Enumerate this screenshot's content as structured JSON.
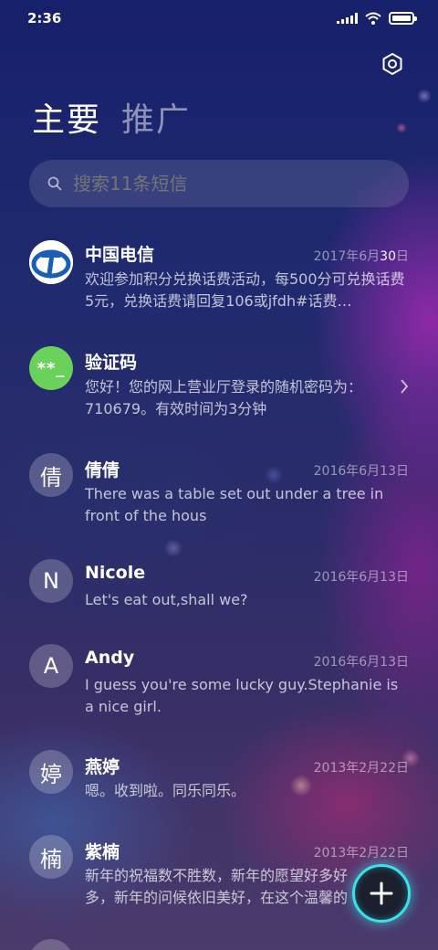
{
  "status_bar": {
    "time": "2:36"
  },
  "tabs": [
    {
      "label": "主要"
    },
    {
      "label": "推广"
    }
  ],
  "search": {
    "placeholder": "搜索11条短信"
  },
  "conversations": [
    {
      "avatar": "",
      "avatar_icon": "china-telecom-logo",
      "name": "中国电信",
      "date_prefix": "2017年6月",
      "date_highlight": "30",
      "date_suffix": "日",
      "preview": "欢迎参加积分兑换话费活动，每500分可兑换话费5元，兑换话费请回复106或jfdh#话费…"
    },
    {
      "avatar": "**_",
      "name": "验证码",
      "date": "",
      "preview": "您好！您的网上营业厅登录的随机密码为：710679。有效时间为3分钟"
    },
    {
      "avatar": "倩",
      "name": "倩倩",
      "date": "2016年6月13日",
      "preview": "There was a table set out under a tree in front of the hous"
    },
    {
      "avatar": "N",
      "name": "Nicole",
      "date": "2016年6月13日",
      "preview": "Let's eat out,shall we?"
    },
    {
      "avatar": "A",
      "name": "Andy",
      "date": "2016年6月13日",
      "preview": "I guess you're some lucky guy.Stephanie is a nice girl."
    },
    {
      "avatar": "婷",
      "name": "燕婷",
      "date": "2013年2月22日",
      "preview": "嗯。收到啦。同乐同乐。"
    },
    {
      "avatar": "楠",
      "name": "紫楠",
      "date": "2013年2月22日",
      "preview": "新年的祝福数不胜数，新年的愿望好多好多，新年的问候依旧美好，在这个温馨的时刻"
    }
  ],
  "fab": {
    "icon": "plus-icon"
  },
  "colors": {
    "fab_ring": "#3be0e8",
    "code_avatar": "#6ad15a",
    "telecom_blue": "#1a5fb4"
  }
}
